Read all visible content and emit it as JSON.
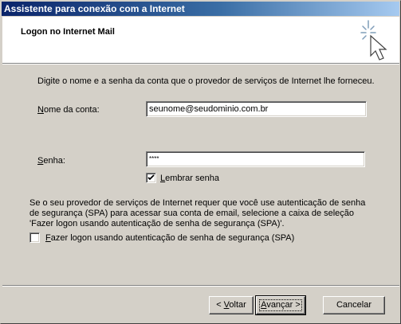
{
  "window": {
    "title": "Assistente para conexão com a Internet"
  },
  "header": {
    "title": "Logon no Internet Mail",
    "icon": "wizard-sparkle-cursor-icon"
  },
  "instructions": "Digite o nome e a senha da conta que o provedor de serviços de Internet lhe forneceu.",
  "account": {
    "label_accel": "N",
    "label_rest": "ome da conta:",
    "value": "seunome@seudominio.com.br"
  },
  "password": {
    "label_accel": "S",
    "label_rest": "enha:",
    "value": "****"
  },
  "remember": {
    "label_accel": "L",
    "label_rest": "embrar senha",
    "checked": true
  },
  "spa": {
    "line1": "Se o seu provedor de serviços de Internet requer que você use autenticação de senha",
    "line2": "de segurança (SPA) para acessar sua conta de email, selecione a caixa de seleção",
    "line3": "'Fazer logon usando autenticação de senha de segurança (SPA)'.",
    "checkbox_accel": "F",
    "checkbox_rest": "azer logon usando autenticação de senha de segurança (SPA)",
    "checked": false
  },
  "buttons": {
    "back_prefix": "< ",
    "back_accel": "V",
    "back_rest": "oltar",
    "next_accel": "A",
    "next_rest": "vançar >",
    "cancel": "Cancelar"
  }
}
